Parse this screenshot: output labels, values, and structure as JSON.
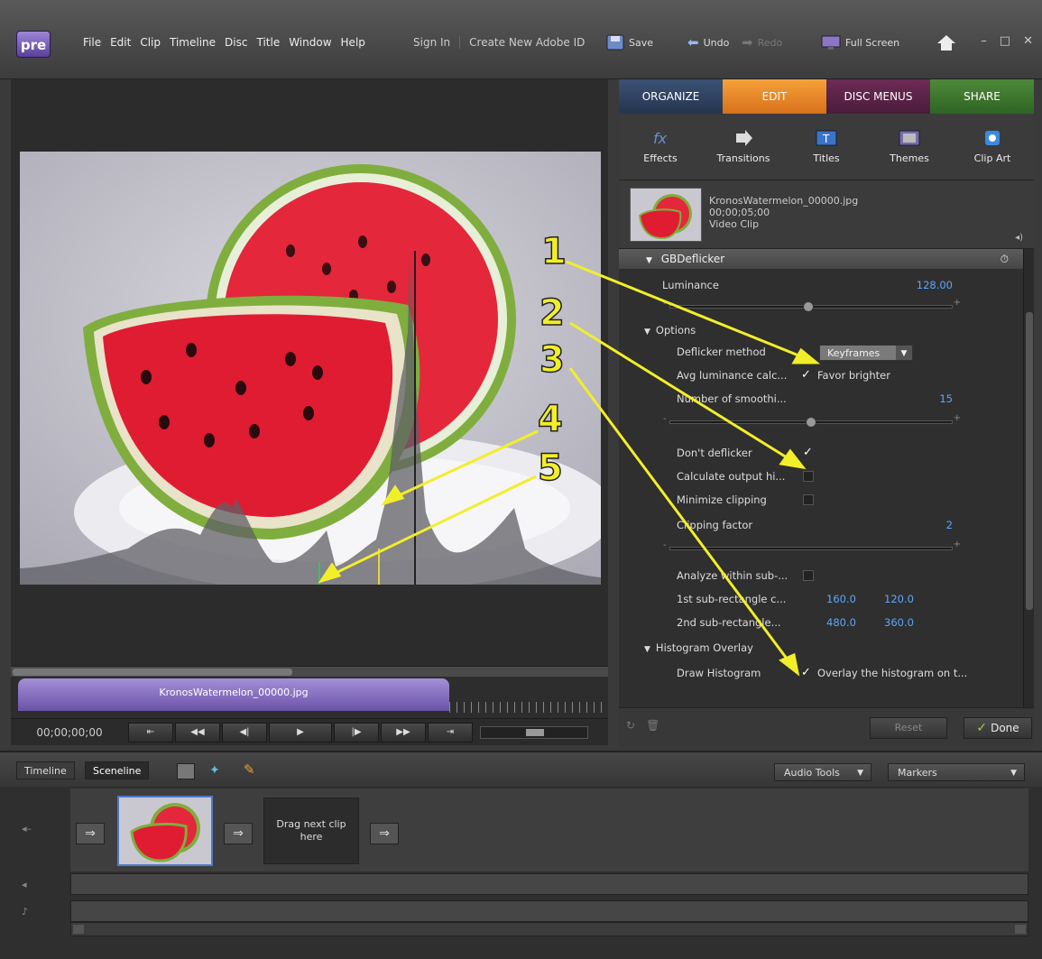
{
  "app": {
    "logo": "pre",
    "menu": [
      "File",
      "Edit",
      "Clip",
      "Timeline",
      "Disc",
      "Title",
      "Window",
      "Help"
    ],
    "sign_in": "Sign In",
    "create_id": "Create New Adobe ID",
    "save": "Save",
    "undo": "Undo",
    "redo": "Redo",
    "fullscreen": "Full Screen"
  },
  "tabs": [
    "ORGANIZE",
    "EDIT",
    "DISC MENUS",
    "SHARE"
  ],
  "tools": [
    "Effects",
    "Transitions",
    "Titles",
    "Themes",
    "Clip Art"
  ],
  "clip": {
    "name": "KronosWatermelon_00000.jpg",
    "duration": "00;00;05;00",
    "type": "Video Clip"
  },
  "effect": {
    "name": "GBDeflicker",
    "luminance_label": "Luminance",
    "luminance_value": "128.00",
    "luminance_level": 0.5,
    "options_label": "Options",
    "method_label": "Deflicker method",
    "method_value": "Keyframes",
    "avg_label": "Avg luminance calc...",
    "favor_brighter": "Favor brighter",
    "smoothing_label": "Number of smoothi...",
    "smoothing_value": "15",
    "smoothing_level": 0.5,
    "dont_deflicker": "Don't deflicker",
    "calc_output": "Calculate output hi...",
    "minimize_clipping": "Minimize clipping",
    "clipping_label": "Clipping factor",
    "clipping_value": "2",
    "analyze_label": "Analyze within sub-...",
    "rect1_label": "1st sub-rectangle c...",
    "rect1_x": "160.0",
    "rect1_y": "120.0",
    "rect2_label": "2nd sub-rectangle...",
    "rect2_x": "480.0",
    "rect2_y": "360.0",
    "histogram_label": "Histogram Overlay",
    "draw_histogram": "Draw Histogram",
    "overlay_text": "Overlay the histogram on t..."
  },
  "footer": {
    "reset": "Reset",
    "done": "Done"
  },
  "monitor": {
    "timecode": "00;00;00;00",
    "clip_label": "KronosWatermelon_00000.jpg"
  },
  "bottom": {
    "tab_timeline": "Timeline",
    "tab_sceneline": "Sceneline",
    "audio_tools": "Audio Tools",
    "markers": "Markers",
    "drag_next": "Drag next clip here"
  },
  "annotations": [
    "1",
    "2",
    "3",
    "4",
    "5"
  ],
  "colors": {
    "accent_edit": "#e98b2a",
    "value_blue": "#5aa6ff",
    "annotation_yellow": "#f2ee2a"
  }
}
